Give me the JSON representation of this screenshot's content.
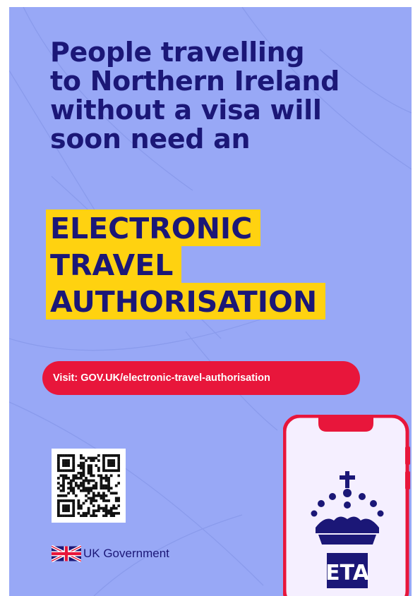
{
  "headline": {
    "lines": [
      "People travelling",
      "to Northern Ireland",
      "without a visa will",
      "soon need an"
    ]
  },
  "eta_title": {
    "lines": [
      "ELECTRONIC",
      "TRAVEL",
      "AUTHORISATION"
    ]
  },
  "visit": {
    "prefix": "Visit:",
    "url": "GOV.UK/electronic-travel-authorisation"
  },
  "qr_code": {
    "icon": "qr-code-icon"
  },
  "government": {
    "flag_icon": "union-flag-icon",
    "label": "UK Government"
  },
  "phone": {
    "crown_icon": "crown-icon",
    "badge_text": "ETA"
  },
  "colors": {
    "background": "#98a8f6",
    "navy": "#1b1777",
    "highlight": "#ffd210",
    "accent_red": "#e8163b"
  }
}
